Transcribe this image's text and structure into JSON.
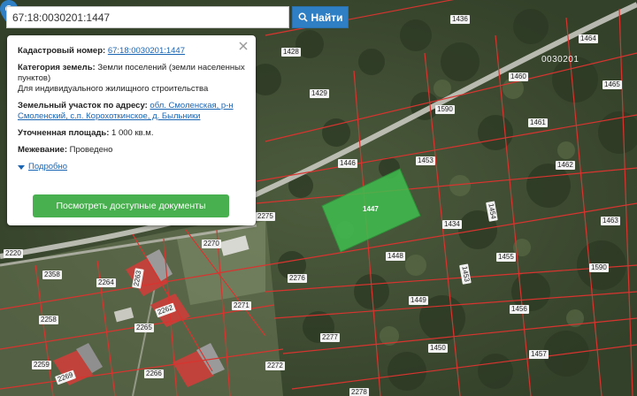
{
  "search": {
    "value": "67:18:0030201:1447",
    "button_label": "Найти",
    "button_icon": "search-icon"
  },
  "popup": {
    "cadastral_label": "Кадастровый номер:",
    "cadastral_value": "67:18:0030201:1447",
    "category_label": "Категория земель:",
    "category_value": "Земли поселений (земли населенных пунктов)",
    "use_value": "Для индивидуального жилищного строительства",
    "address_label": "Земельный участок по адресу:",
    "address_value": "обл. Смоленская, р-н Смоленский, с.п. Корохоткинское, д. Быльники",
    "area_label": "Уточненная площадь:",
    "area_value": "1 000 кв.м.",
    "survey_label": "Межевание:",
    "survey_value": "Проведено",
    "more_label": "Подробно",
    "docs_button": "Посмотреть доступные документы",
    "close_icon": "close-icon"
  },
  "map": {
    "block_number": "0030201",
    "pin_label": "1447",
    "parcels": [
      "1436",
      "1464",
      "1428",
      "1460",
      "1465",
      "1429",
      "1590",
      "1461",
      "1446",
      "1453",
      "1462",
      "1463",
      "2275",
      "1454",
      "1434",
      "2270",
      "2220",
      "1448",
      "1455",
      "1590",
      "2358",
      "2264",
      "1453",
      "2276",
      "2263",
      "1449",
      "2271",
      "1456",
      "2262",
      "2258",
      "2265",
      "2277",
      "1450",
      "1457",
      "2259",
      "2266",
      "2272",
      "2269",
      "2278"
    ],
    "colors": {
      "highlight": "#3fbe4e",
      "boundary": "#d8342f",
      "road": "#cfcfc8",
      "accent": "#2f7fc4",
      "button": "#48b04e"
    }
  }
}
